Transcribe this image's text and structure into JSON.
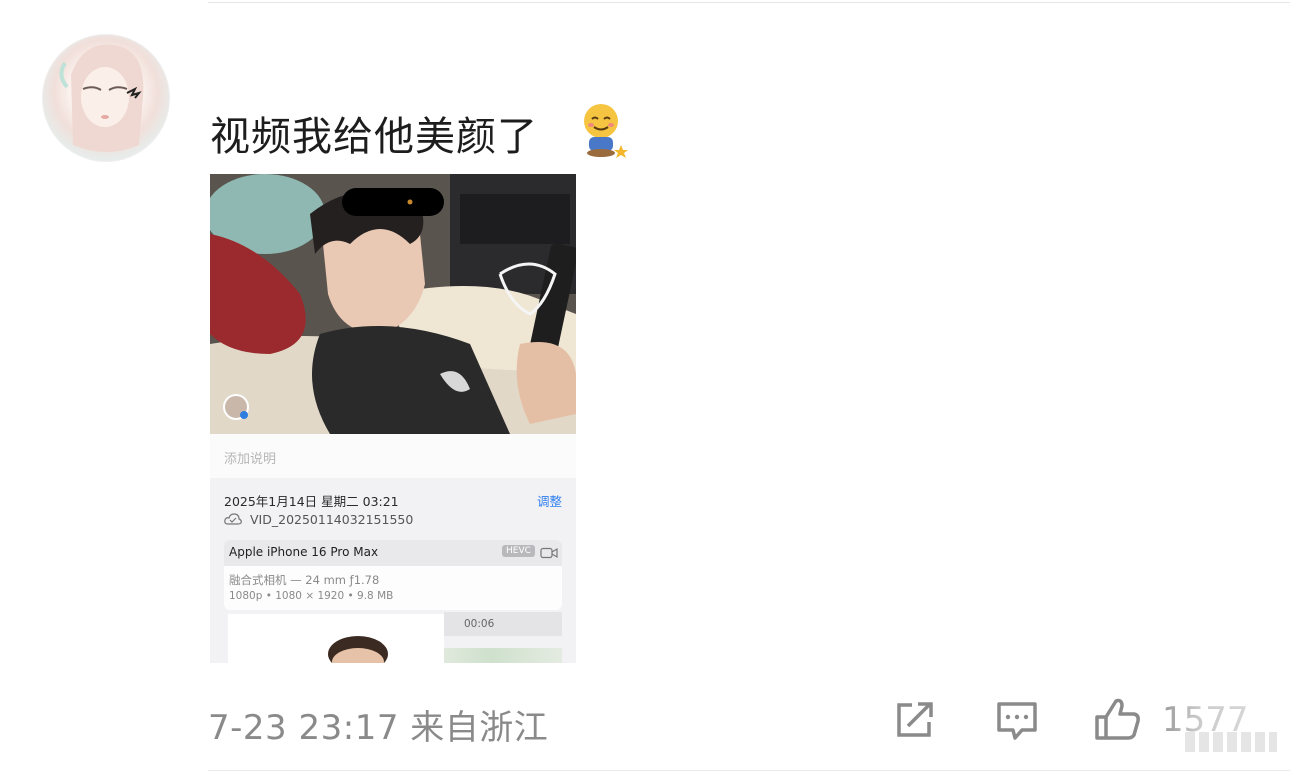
{
  "post": {
    "text": "视频我给他美颜了",
    "emoji": "smile-sitting-emoji"
  },
  "screenshot": {
    "caption_placeholder": "添加说明",
    "date": "2025年1月14日 星期二 03:21",
    "adjust_label": "调整",
    "filename": "VID_20250114032151550",
    "device": "Apple iPhone 16 Pro Max",
    "format_badge": "HEVC",
    "lens": "融合式相机 — 24 mm ƒ1.78",
    "spec": "1080p • 1080 × 1920 • 9.8 MB",
    "timecode": "00:06"
  },
  "footer": {
    "meta": "7-23 23:17 来自浙江",
    "like_count": "1577"
  },
  "icons": {
    "share": "share-icon",
    "comment": "comment-icon",
    "like": "thumbs-up-icon"
  },
  "colors": {
    "text": "#1d1d1d",
    "meta": "#8a8a8a",
    "accent": "#2e7ef0"
  }
}
